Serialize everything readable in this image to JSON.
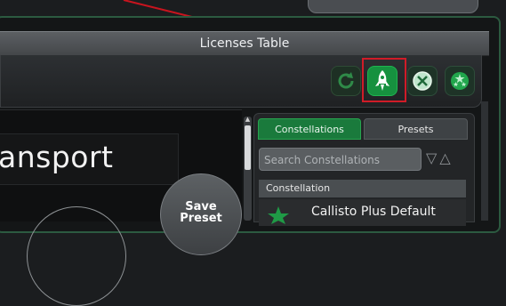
{
  "window": {
    "title": "Licenses Table"
  },
  "toolbar": {
    "buttons": [
      {
        "icon": "refresh-icon"
      },
      {
        "icon": "rocket-icon"
      },
      {
        "icon": "close-circle-icon"
      },
      {
        "icon": "stars-icon"
      }
    ]
  },
  "left_panel": {
    "heading_partial": "ansport",
    "save_button": {
      "line1": "Save",
      "line2": "Preset"
    }
  },
  "right_panel": {
    "tabs": [
      {
        "label": "Constellations",
        "active": true
      },
      {
        "label": "Presets",
        "active": false
      }
    ],
    "search": {
      "placeholder": "Search Constellations"
    },
    "list": {
      "column_header": "Constellation",
      "rows": [
        {
          "label": "Callisto Plus Default"
        }
      ]
    }
  },
  "colors": {
    "accent_green": "#16913f",
    "highlight_red": "#d01c28",
    "title_bar": "#55585c"
  }
}
